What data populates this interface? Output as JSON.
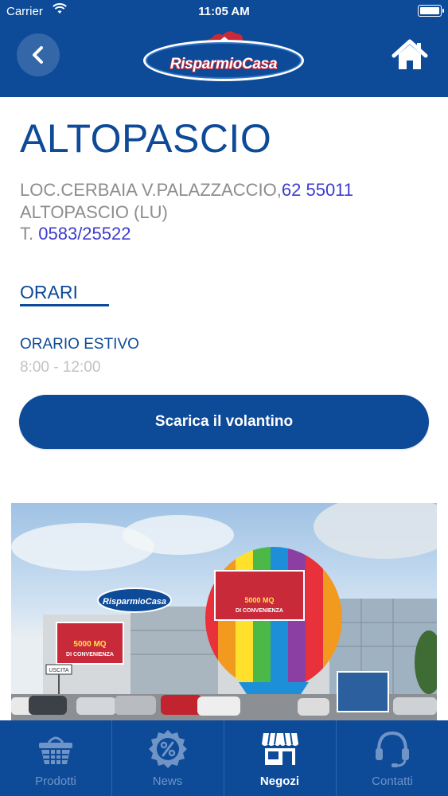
{
  "status_bar": {
    "carrier": "Carrier",
    "time": "11:05 AM"
  },
  "header": {
    "logo_text": "RisparmioCasa"
  },
  "store": {
    "name": "ALTOPASCIO",
    "address_prefix": "LOC.CERBAIA V.PALAZZACCIO,",
    "address_link": "62 55011",
    "city": "ALTOPASCIO (LU)",
    "phone_prefix": "T.",
    "phone": "0583/25522"
  },
  "schedule": {
    "heading": "ORARI",
    "season_label": "ORARIO ESTIVO",
    "hours": "8:00 - 12:00"
  },
  "download_button": "Scarica il volantino",
  "photo": {
    "sign_text": "RisparmioCasa",
    "banner_line1": "5000 MQ",
    "banner_line2": "DI CONVENIENZA",
    "exit_sign": "USCITA"
  },
  "tabs": [
    {
      "label": "Prodotti",
      "icon": "basket-icon",
      "active": false
    },
    {
      "label": "News",
      "icon": "percent-badge-icon",
      "active": false
    },
    {
      "label": "Negozi",
      "icon": "store-icon",
      "active": true
    },
    {
      "label": "Contatti",
      "icon": "headset-icon",
      "active": false
    }
  ],
  "colors": {
    "primary": "#0d4a98",
    "text_gray": "#8d8d8d",
    "link": "#3b3bd0",
    "hours_gray": "#c2c2c2"
  }
}
